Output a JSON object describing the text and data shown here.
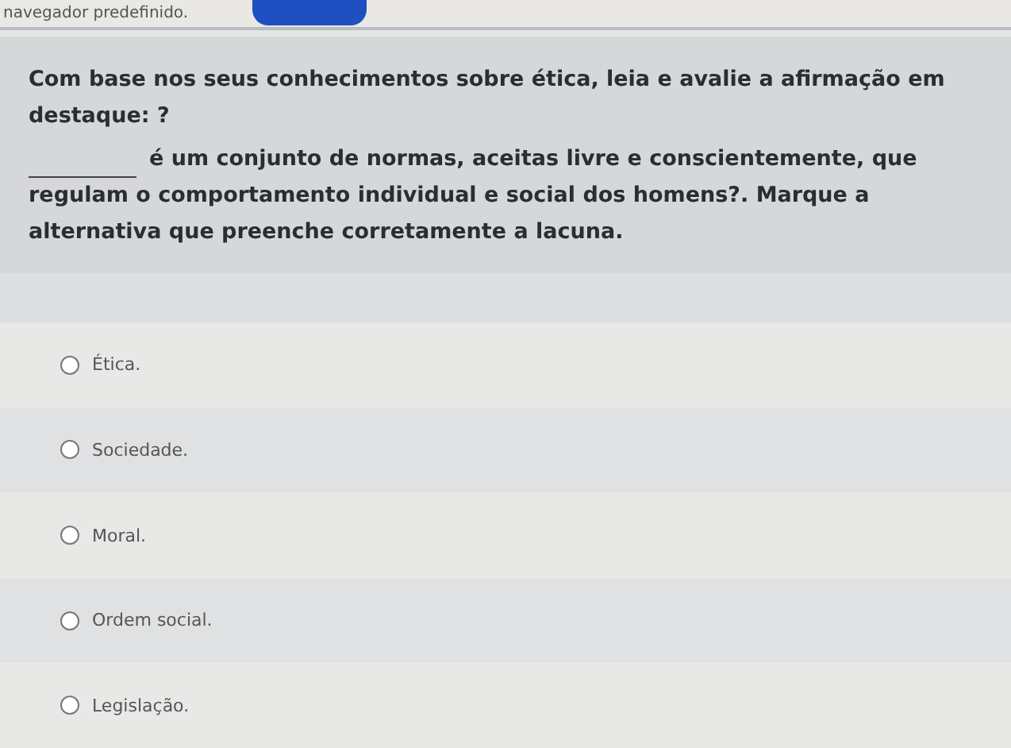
{
  "notice_bar": {
    "text": "navegador predefinido.",
    "button": {
      "visible": true
    }
  },
  "question": {
    "prompt": "Com base nos seus conhecimentos sobre ética, leia e avalie a afirmação em destaque: ?",
    "blank": true,
    "statement": "é um conjunto de normas, aceitas livre e conscientemente, que regulam o comportamento individual e social dos homens?. Marque a alternativa que preenche corretamente a lacuna."
  },
  "options": [
    {
      "label": "Ética.",
      "selected": false
    },
    {
      "label": "Sociedade.",
      "selected": false
    },
    {
      "label": "Moral.",
      "selected": false
    },
    {
      "label": "Ordem social.",
      "selected": false
    },
    {
      "label": "Legislação.",
      "selected": false
    }
  ]
}
